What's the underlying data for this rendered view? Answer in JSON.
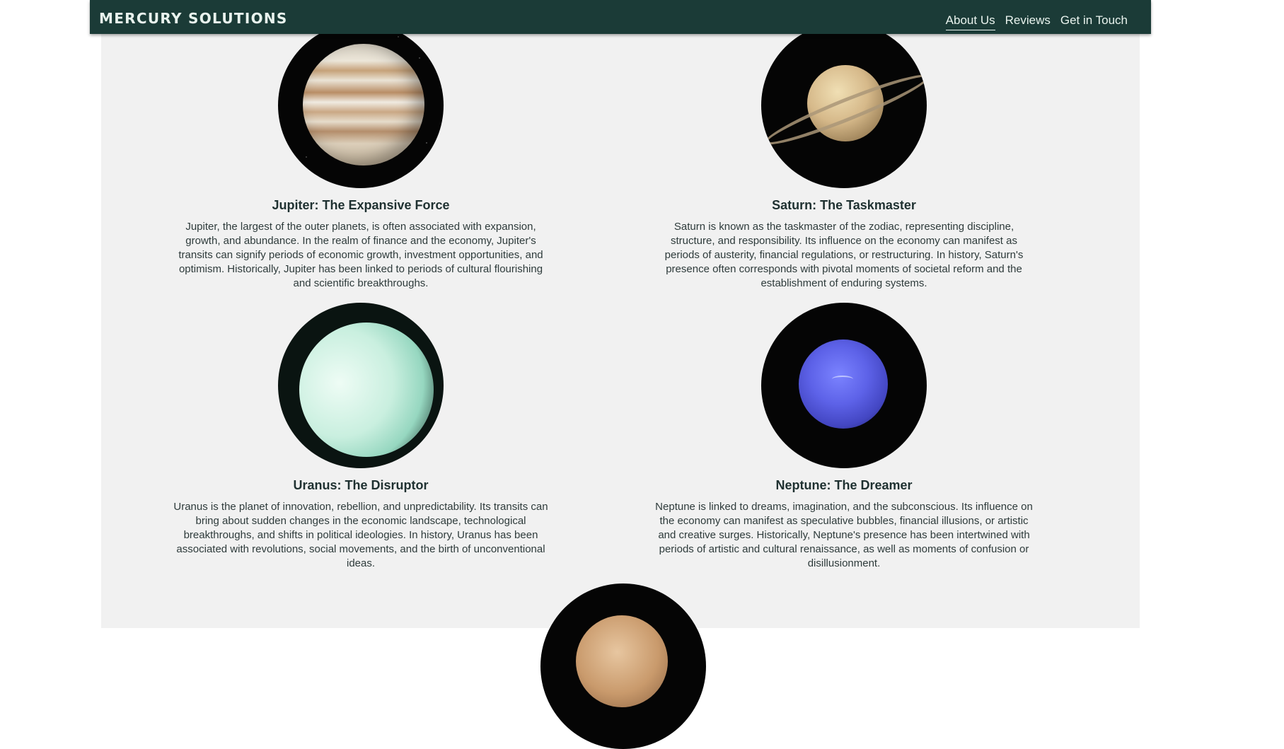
{
  "header": {
    "brand": "MERCURY SOLUTIONS",
    "nav": [
      "About Us",
      "Reviews",
      "Get in Touch"
    ],
    "active_nav": "About Us"
  },
  "planets": [
    {
      "title": "Jupiter: The Expansive Force",
      "text": "Jupiter, the largest of the outer planets, is often associated with expansion, growth, and abundance. In the realm of finance and the economy, Jupiter's transits can signify periods of economic growth, investment opportunities, and optimism. Historically, Jupiter has been linked to periods of cultural flourishing and scientific breakthroughs."
    },
    {
      "title": "Saturn: The Taskmaster",
      "text": "Saturn is known as the taskmaster of the zodiac, representing discipline, structure, and responsibility. Its influence on the economy can manifest as periods of austerity, financial regulations, or restructuring. In history, Saturn's presence often corresponds with pivotal moments of societal reform and the establishment of enduring systems."
    },
    {
      "title": "Uranus: The Disruptor",
      "text": "Uranus is the planet of innovation, rebellion, and unpredictability. Its transits can bring about sudden changes in the economic landscape, technological breakthroughs, and shifts in political ideologies. In history, Uranus has been associated with revolutions, social movements, and the birth of unconventional ideas."
    },
    {
      "title": "Neptune: The Dreamer",
      "text": "Neptune is linked to dreams, imagination, and the subconscious. Its influence on the economy can manifest as speculative bubbles, financial illusions, or artistic and creative surges. Historically, Neptune's presence has been intertwined with periods of artistic and cultural renaissance, as well as moments of confusion or disillusionment."
    }
  ],
  "colors": {
    "header_bg": "#1b3b37",
    "content_bg": "#f1f1f1",
    "text": "#2e3b3b"
  }
}
